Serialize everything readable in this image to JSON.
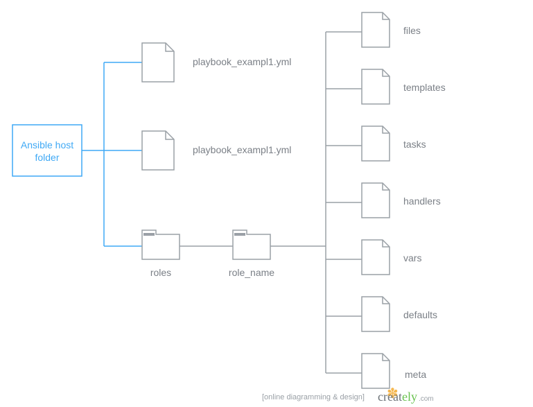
{
  "root": {
    "label_line1": "Ansible host",
    "label_line2": "folder"
  },
  "level1": {
    "playbook1": "playbook_exampl1.yml",
    "playbook2": "playbook_exampl1.yml",
    "roles": "roles"
  },
  "rolename": "role_name",
  "subfolders": {
    "files": "files",
    "templates": "templates",
    "tasks": "tasks",
    "handlers": "handlers",
    "vars": "vars",
    "defaults": "defaults",
    "meta": "meta"
  },
  "footer": "[online diagramming & design]",
  "logo": {
    "part1": "creat",
    "part2": "ely",
    "suffix": ".com"
  }
}
